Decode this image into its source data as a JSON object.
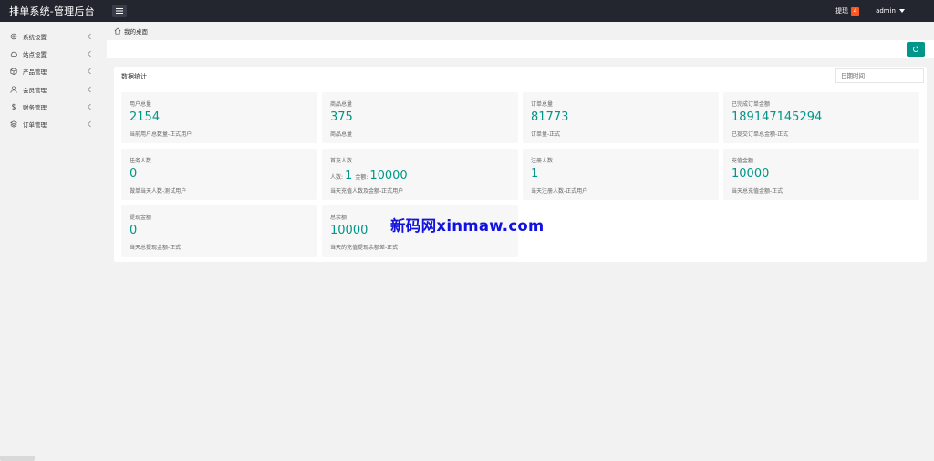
{
  "header": {
    "title": "排单系统-管理后台",
    "notice_label": "提现",
    "notice_count": "4",
    "user": "admin"
  },
  "sidebar": {
    "items": [
      {
        "label": "系统设置",
        "icon": "gear-icon"
      },
      {
        "label": "站点设置",
        "icon": "cloud-icon"
      },
      {
        "label": "产品管理",
        "icon": "box-icon"
      },
      {
        "label": "会员管理",
        "icon": "user-icon"
      },
      {
        "label": "财务管理",
        "icon": "dollar-icon"
      },
      {
        "label": "订单管理",
        "icon": "stack-icon"
      }
    ]
  },
  "breadcrumb": {
    "label": "我的桌面"
  },
  "panel": {
    "title": "数据统计",
    "date_placeholder": "日期时间"
  },
  "cards": [
    {
      "title": "用户总量",
      "value": "2154",
      "desc": "当前用户总数量-正式用户"
    },
    {
      "title": "商品总量",
      "value": "375",
      "desc": "商品总量"
    },
    {
      "title": "订单总量",
      "value": "81773",
      "desc": "订单量-正式"
    },
    {
      "title": "已完成订单金额",
      "value": "189147145294",
      "desc": "已提交订单总金额-正式"
    },
    {
      "title": "任务人数",
      "value": "0",
      "desc": "做单当天人数-测试用户"
    },
    {
      "title": "首充人数",
      "people_label": "人数:",
      "people_value": "1",
      "amount_label": "金额:",
      "amount_value": "10000",
      "desc": "当天充值人数及金额-正式用户"
    },
    {
      "title": "注册人数",
      "value": "1",
      "desc": "当天注册人数-正式用户"
    },
    {
      "title": "充值金额",
      "value": "10000",
      "desc": "当天总充值金额-正式"
    },
    {
      "title": "提现金额",
      "value": "0",
      "desc": "当天总提现金额-正式"
    },
    {
      "title": "总余额",
      "value": "10000",
      "desc": "当天的充值提现余额差-正式"
    }
  ],
  "watermark": "新码网xinmaw.com",
  "colors": {
    "header_bg": "#23262e",
    "accent": "#009688",
    "badge": "#ff5722",
    "watermark": "#1212e0"
  }
}
